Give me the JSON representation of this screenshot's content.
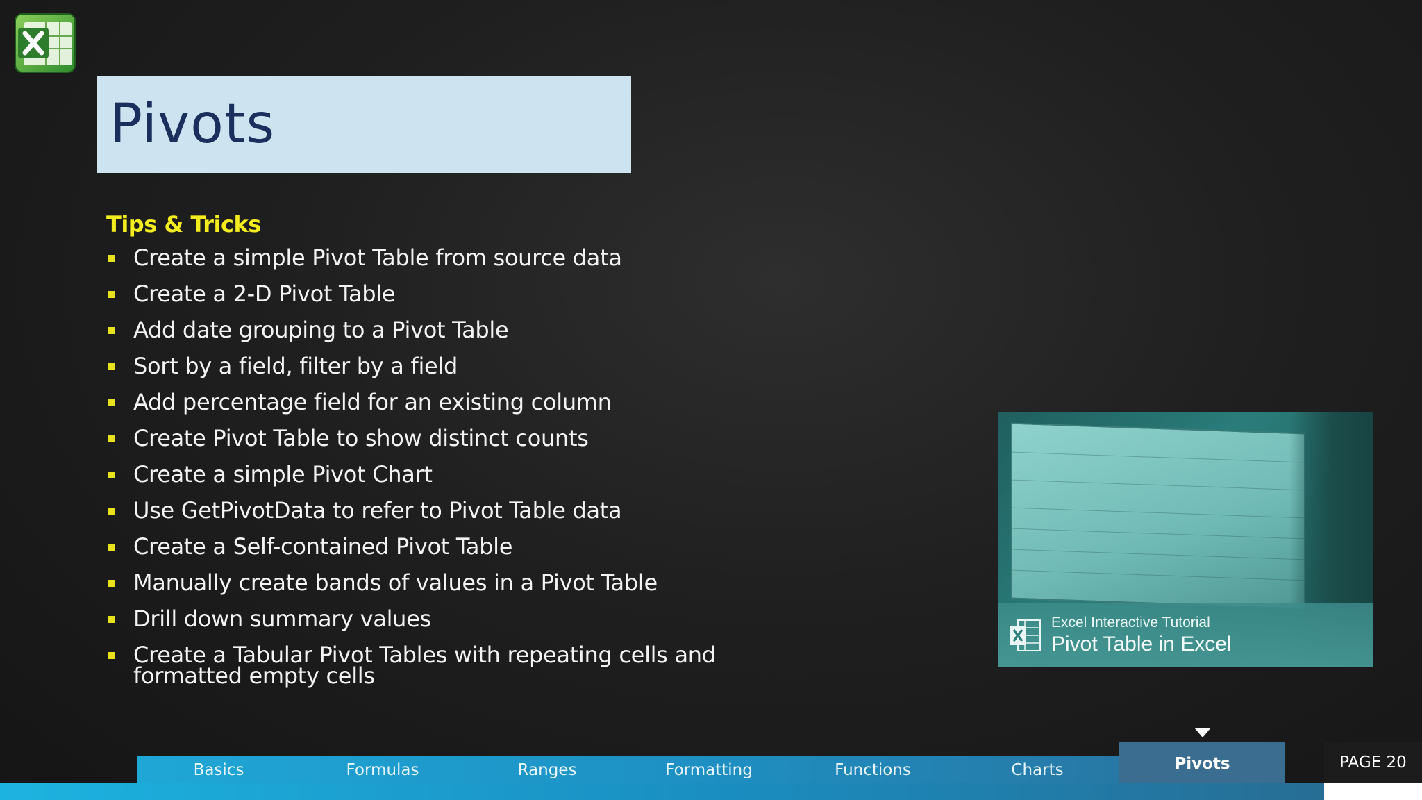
{
  "slide": {
    "title": "Pivots",
    "section_heading": "Tips & Tricks",
    "tips": [
      "Create a simple Pivot Table from source data",
      "Create a 2-D Pivot Table",
      "Add date grouping to a Pivot Table",
      "Sort by a field, filter by a field",
      "Add percentage field for an existing column",
      "Create Pivot Table to show distinct counts",
      "Create a simple Pivot Chart",
      "Use GetPivotData to refer to Pivot Table data",
      "Create a Self-contained Pivot Table",
      "Manually create bands of values in a Pivot Table",
      "Drill down summary values",
      "Create a Tabular Pivot Tables with repeating cells and formatted empty cells"
    ]
  },
  "video": {
    "caption_small": "Excel Interactive Tutorial",
    "caption_large": "Pivot Table in Excel",
    "icon": "excel-logo-icon"
  },
  "nav": {
    "tabs": [
      "Basics",
      "Formulas",
      "Ranges",
      "Formatting",
      "Functions",
      "Charts"
    ],
    "active_tab": "Pivots"
  },
  "page_label": "PAGE 20",
  "colors": {
    "title_bg": "#cde3f0",
    "title_text": "#1b2f5c",
    "heading": "#f3ec1e",
    "bullet": "#e8e21c",
    "nav": "#1fa7d6",
    "nav_active": "#3b6d91"
  }
}
